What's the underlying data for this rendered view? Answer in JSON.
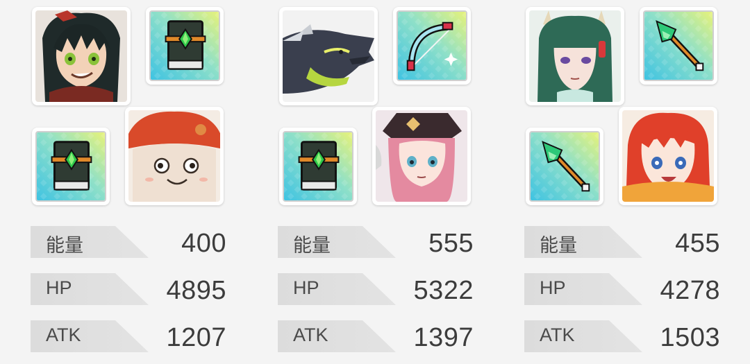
{
  "teams": [
    {
      "members": [
        {
          "portrait": "boy-hero-green-eyes-portrait",
          "item": "green-gem-book-icon"
        },
        {
          "portrait": "mushroom-creature-portrait",
          "item": "green-gem-book-icon"
        }
      ],
      "stats": [
        {
          "label": "能量",
          "value": "400"
        },
        {
          "label": "HP",
          "value": "4895"
        },
        {
          "label": "ATK",
          "value": "1207"
        }
      ]
    },
    {
      "members": [
        {
          "portrait": "dark-dragon-portrait",
          "item": "crystal-bow-icon"
        },
        {
          "portrait": "pink-hair-captain-girl-portrait",
          "item": "green-gem-book-icon"
        }
      ],
      "stats": [
        {
          "label": "能量",
          "value": "555"
        },
        {
          "label": "HP",
          "value": "5322"
        },
        {
          "label": "ATK",
          "value": "1397"
        }
      ]
    },
    {
      "members": [
        {
          "portrait": "horned-green-hair-woman-portrait",
          "item": "jade-spear-icon"
        },
        {
          "portrait": "red-hair-girl-portrait",
          "item": "jade-spear-icon"
        }
      ],
      "stats": [
        {
          "label": "能量",
          "value": "455"
        },
        {
          "label": "HP",
          "value": "4278"
        },
        {
          "label": "ATK",
          "value": "1503"
        }
      ]
    }
  ],
  "colors": {
    "background": "#f4f4f4",
    "stat_tab": "#dcdcdc",
    "value_text": "#3c3c3c",
    "item_frame_gradient": [
      "#5fd0e6",
      "#d8ef7a"
    ]
  }
}
